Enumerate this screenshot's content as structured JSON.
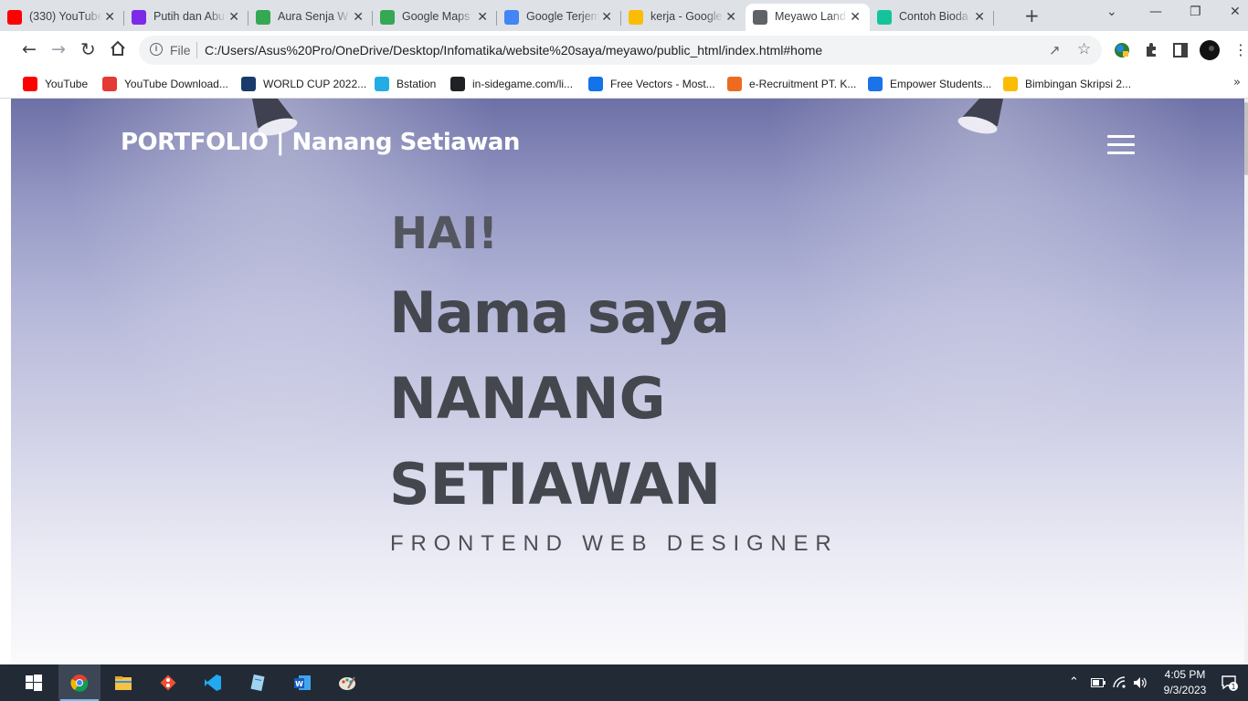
{
  "browser": {
    "tabs": [
      {
        "label": "(330) YouTube",
        "icon": "youtube-icon",
        "color": "#ff0000"
      },
      {
        "label": "Putih dan Abu",
        "icon": "canva-icon",
        "color": "#7d2ae8"
      },
      {
        "label": "Aura Senja W",
        "icon": "maps-icon",
        "color": "#34a853"
      },
      {
        "label": "Google Maps",
        "icon": "maps-icon",
        "color": "#34a853"
      },
      {
        "label": "Google Terjem",
        "icon": "translate-icon",
        "color": "#4285f4"
      },
      {
        "label": "kerja - Google",
        "icon": "drive-icon",
        "color": "#fbbc04"
      },
      {
        "label": "Meyawo Land",
        "icon": "globe-icon",
        "color": "#5f6368"
      },
      {
        "label": "Contoh Bioda",
        "icon": "grammarly-icon",
        "color": "#15c39a"
      }
    ],
    "active_tab_index": 6,
    "new_tab_symbol": "+",
    "omnibox": {
      "scheme_label": "File",
      "url": "C:/Users/Asus%20Pro/OneDrive/Desktop/Infomatika/website%20saya/meyawo/public_html/index.html#home"
    },
    "bookmarks": [
      {
        "label": "YouTube",
        "icon": "youtube-icon",
        "color": "#ff0000"
      },
      {
        "label": "YouTube Download...",
        "icon": "download-icon",
        "color": "#e53935"
      },
      {
        "label": "WORLD CUP 2022...",
        "icon": "arrow-logo-icon",
        "color": "#1a3a6b"
      },
      {
        "label": "Bstation",
        "icon": "bstation-icon",
        "color": "#23ade5"
      },
      {
        "label": "in-sidegame.com/li...",
        "icon": "playstation-icon",
        "color": "#202124"
      },
      {
        "label": "Free Vectors - Most...",
        "icon": "freepik-icon",
        "color": "#1273eb"
      },
      {
        "label": "e-Recruitment PT. K...",
        "icon": "kai-icon",
        "color": "#ed6b21"
      },
      {
        "label": "Empower Students...",
        "icon": "link-icon",
        "color": "#1a73e8"
      },
      {
        "label": "Bimbingan Skripsi 2...",
        "icon": "drive-icon",
        "color": "#fbbc04"
      }
    ],
    "bookmarks_overflow": "»"
  },
  "site": {
    "brand": "PORTFOLIO | Nanang Setiawan",
    "greeting": "HAI!",
    "headline_line1": "Nama saya",
    "headline_line2": "NANANG",
    "headline_line3": "SETIAWAN",
    "role": "FRONTEND WEB DESIGNER"
  },
  "taskbar": {
    "apps": [
      "start-icon",
      "chrome-icon",
      "file-explorer-icon",
      "git-icon",
      "vscode-icon",
      "notepad-icon",
      "word-icon",
      "paint-icon"
    ],
    "time": "4:05 PM",
    "date": "9/3/2023",
    "notification_count": "1"
  }
}
